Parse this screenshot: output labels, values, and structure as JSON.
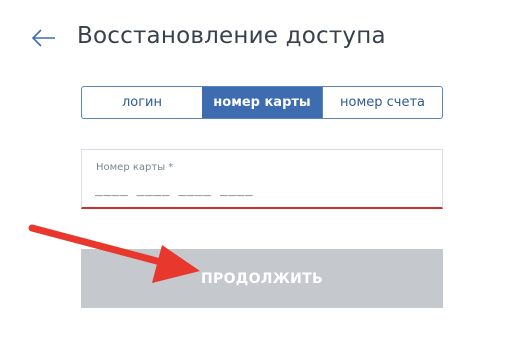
{
  "header": {
    "back_icon": "arrow-left-icon",
    "title": "Восстановление доступа"
  },
  "tabs": [
    {
      "label": "логин",
      "active": false
    },
    {
      "label": "номер карты",
      "active": true
    },
    {
      "label": "номер счета",
      "active": false
    }
  ],
  "card_field": {
    "label": "Номер карты *",
    "placeholder": "____ ____ ____ ____",
    "value": ""
  },
  "continue_button": {
    "label": "ПРОДОЛЖИТЬ",
    "state": "disabled"
  },
  "colors": {
    "accent": "#3d6db0",
    "tab_border": "#5a86c0",
    "error_underline": "#d0312d",
    "button_disabled": "#c5c8cc",
    "annotation_arrow": "#e8372c"
  }
}
